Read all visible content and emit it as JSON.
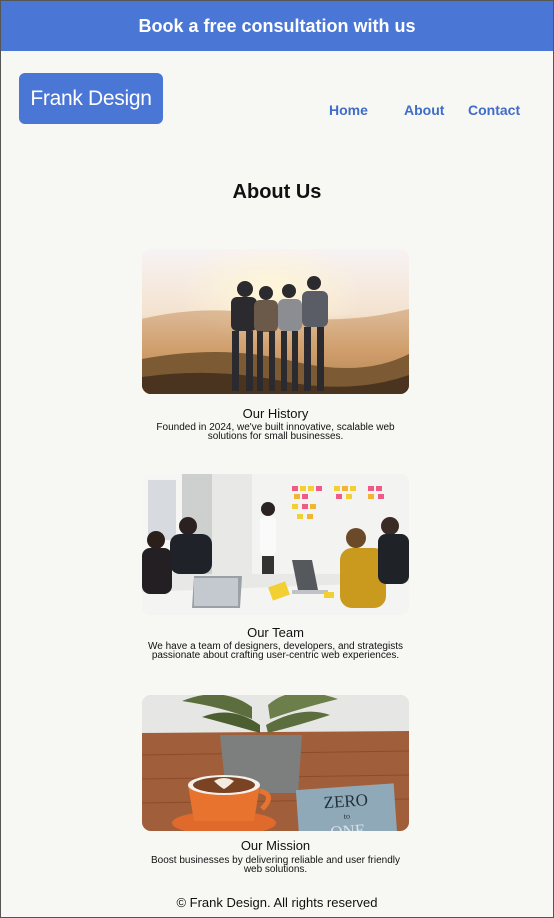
{
  "banner": {
    "label": "Book a free consultation with us"
  },
  "brand": {
    "logo_text": "Frank Design"
  },
  "nav": {
    "items": [
      "Home",
      "About",
      "Contact"
    ]
  },
  "page": {
    "title": "About Us"
  },
  "cards": [
    {
      "title": "Our History",
      "text": "Founded in 2024, we've built innovative, scalable web solutions for  small businesses."
    },
    {
      "title": "Our  Team",
      "text": "We have a team of designers, developers, and strategists passionate about crafting user-centric web experiences."
    },
    {
      "title": "Our Mission",
      "text": "Boost businesses by delivering reliable and user friendly web solutions."
    }
  ],
  "mission_book": {
    "line1": "ZERO",
    "line2": "to",
    "line3": "ONE"
  },
  "footer": {
    "text": "© Frank Design. All rights reserved"
  },
  "colors": {
    "brand": "#4a77d6",
    "nav_link": "#3f6cc8",
    "background": "#f7f8f4"
  }
}
